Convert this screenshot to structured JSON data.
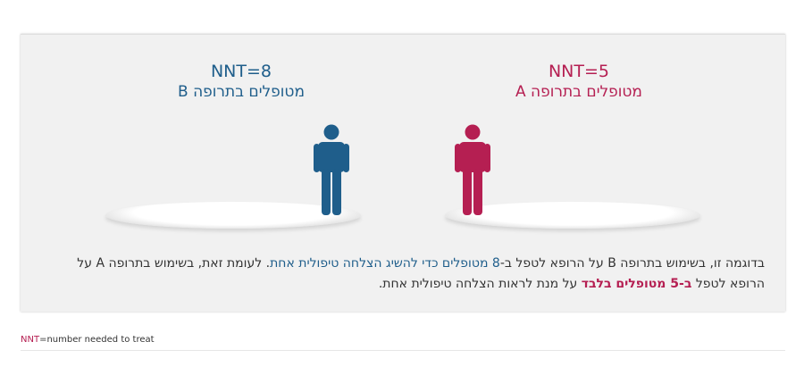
{
  "drug_b": {
    "nnt": "NNT=8",
    "label": "מטופלים בתרופה B",
    "color": "#1f5e8b",
    "icon": "person-icon"
  },
  "drug_a": {
    "nnt": "NNT=5",
    "label": "מטופלים בתרופה A",
    "color": "#b51f52",
    "icon": "person-icon"
  },
  "explanation": {
    "part1": "בדוגמה זו, בשימוש בתרופה B על הרופא לטפל ב-",
    "hl_count": "8 מטופלים כדי להשיג הצלחה טיפולית אחת",
    "part2": ". לעומת זאת, בשימוש בתרופה A על הרופא לטפל ",
    "hl_only": "ב-5 מטופלים בלבד",
    "part3": " על מנת לראות הצלחה טיפולית אחת."
  },
  "footnote": {
    "key": "NNT",
    "definition": "=number needed to treat"
  }
}
